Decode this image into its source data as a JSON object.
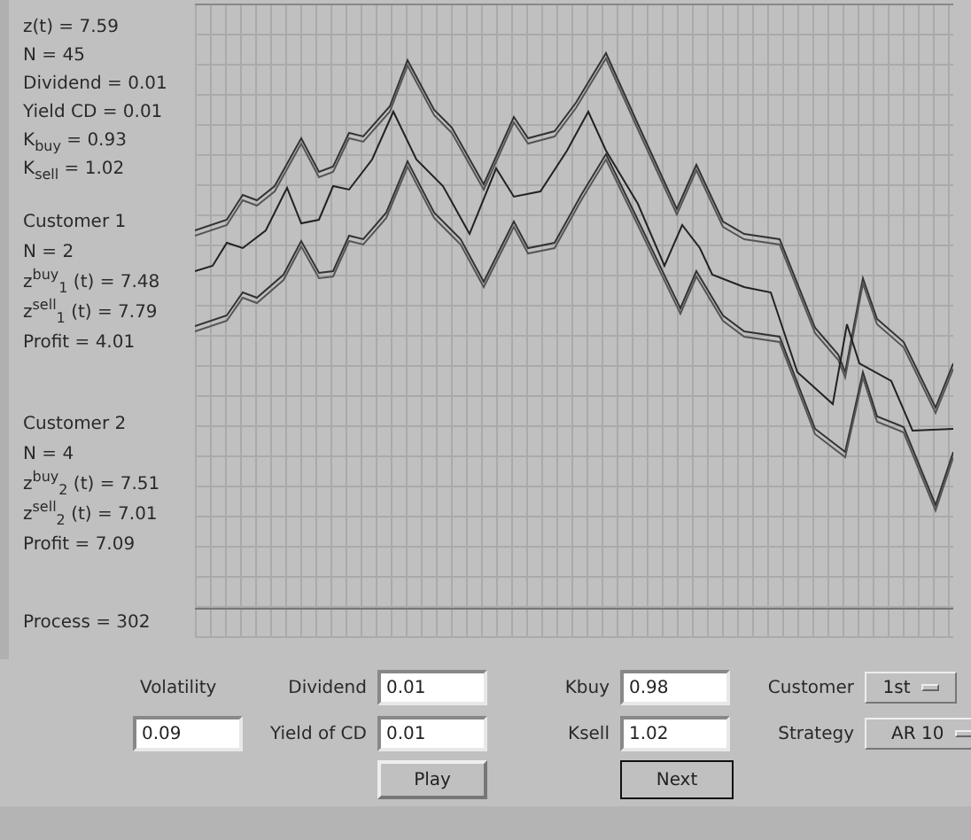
{
  "summary": [
    "z(t) = 7.59",
    "N = 45",
    "Dividend = 0.01",
    "Yield CD = 0.01",
    "K$_{buy}$ = 0.93",
    "K$_{sell}$ = 1.02"
  ],
  "customers": [
    {
      "title": "Customer 1",
      "lines": [
        "N = 2",
        "z$^{buy}$$_{1}$ (t) = 7.48",
        "z$^{sell}$$_{1}$ (t) = 7.79",
        "Profit = 4.01"
      ]
    },
    {
      "title": "Customer 2",
      "lines": [
        "N = 4",
        "z$^{buy}$$_{2}$ (t) = 7.51",
        "z$^{sell}$$_{2}$ (t) = 7.01",
        "Profit = 7.09"
      ]
    }
  ],
  "process": "Process = 302",
  "controls": {
    "volatility": {
      "label": "Volatility",
      "value": "0.09"
    },
    "dividend": {
      "label": "Dividend",
      "value": "0.01"
    },
    "yield_of_cd": {
      "label": "Yield of CD",
      "value": "0.01"
    },
    "kbuy": {
      "label": "Kbuy",
      "value": "0.98"
    },
    "ksell": {
      "label": "Ksell",
      "value": "1.02"
    },
    "customer": {
      "label": "Customer",
      "value": "1st"
    },
    "strategy": {
      "label": "Strategy",
      "value": "AR 10"
    }
  },
  "buttons": [
    {
      "label": "Play",
      "focused": false
    },
    {
      "label": "Next",
      "focused": true
    }
  ]
}
